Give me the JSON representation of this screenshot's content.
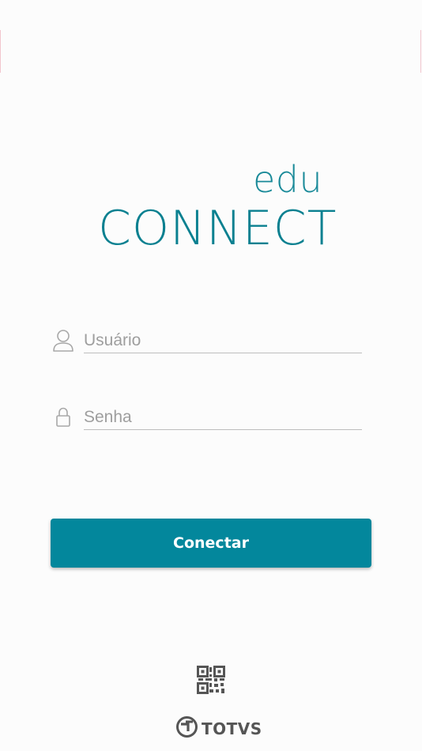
{
  "logo": {
    "edu": "edu",
    "connect": "CONNECT"
  },
  "login": {
    "username": {
      "placeholder": "Usuário",
      "value": "",
      "icon": "user-icon"
    },
    "password": {
      "placeholder": "Senha",
      "value": "",
      "icon": "lock-icon"
    },
    "submit_label": "Conectar"
  },
  "footer": {
    "qr_icon": "qr-code-icon",
    "brand": "TOTVS",
    "brand_icon": "totvs-logo-icon"
  },
  "colors": {
    "accent": "#03879c",
    "logo": "#1a8a99",
    "background": "#fcfcfc"
  }
}
